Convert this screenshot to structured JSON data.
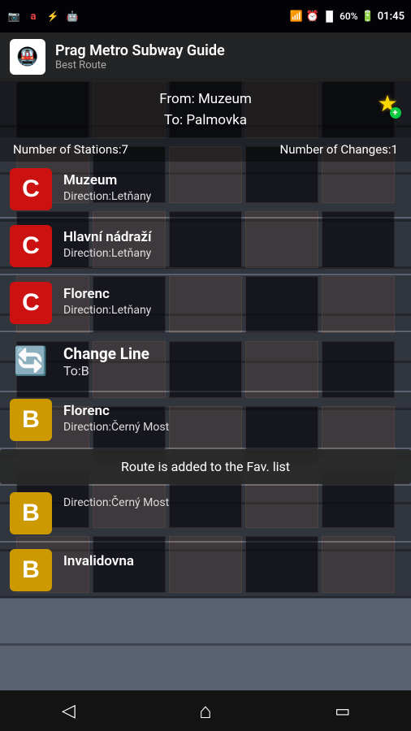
{
  "statusBar": {
    "time": "01:45",
    "battery": "60%",
    "icons": [
      "screenshot",
      "avast",
      "usb",
      "android"
    ]
  },
  "header": {
    "appTitle": "Prag Metro Subway Guide",
    "appSubtitle": "Best Route",
    "appIcon": "🚇"
  },
  "route": {
    "from": "From: Muzeum",
    "to": "To: Palmovka",
    "numberOfStations": "Number of Stations:7",
    "numberOfChanges": "Number of Changes:1"
  },
  "stations": [
    {
      "line": "C",
      "lineClass": "line-c",
      "name": "Muzeum",
      "direction": "Direction:Letňany"
    },
    {
      "line": "C",
      "lineClass": "line-c",
      "name": "Hlavní nádraží",
      "direction": "Direction:Letňany"
    },
    {
      "line": "C",
      "lineClass": "line-c",
      "name": "Florenc",
      "direction": "Direction:Letňany"
    }
  ],
  "changeLine": {
    "label": "Change Line",
    "to": "To:B"
  },
  "stationsB": [
    {
      "line": "B",
      "lineClass": "line-b",
      "name": "Florenc",
      "direction": "Direction:Černý Most"
    },
    {
      "line": "B",
      "lineClass": "line-b",
      "name": "",
      "direction": "Direction:Černý Most"
    }
  ],
  "lastStation": {
    "line": "B",
    "lineClass": "line-b",
    "name": "Invalidovna"
  },
  "tooltip": {
    "text": "Route is added to the Fav. list"
  },
  "bottomNav": {
    "back": "◁",
    "home": "⌂",
    "recent": "▭"
  }
}
